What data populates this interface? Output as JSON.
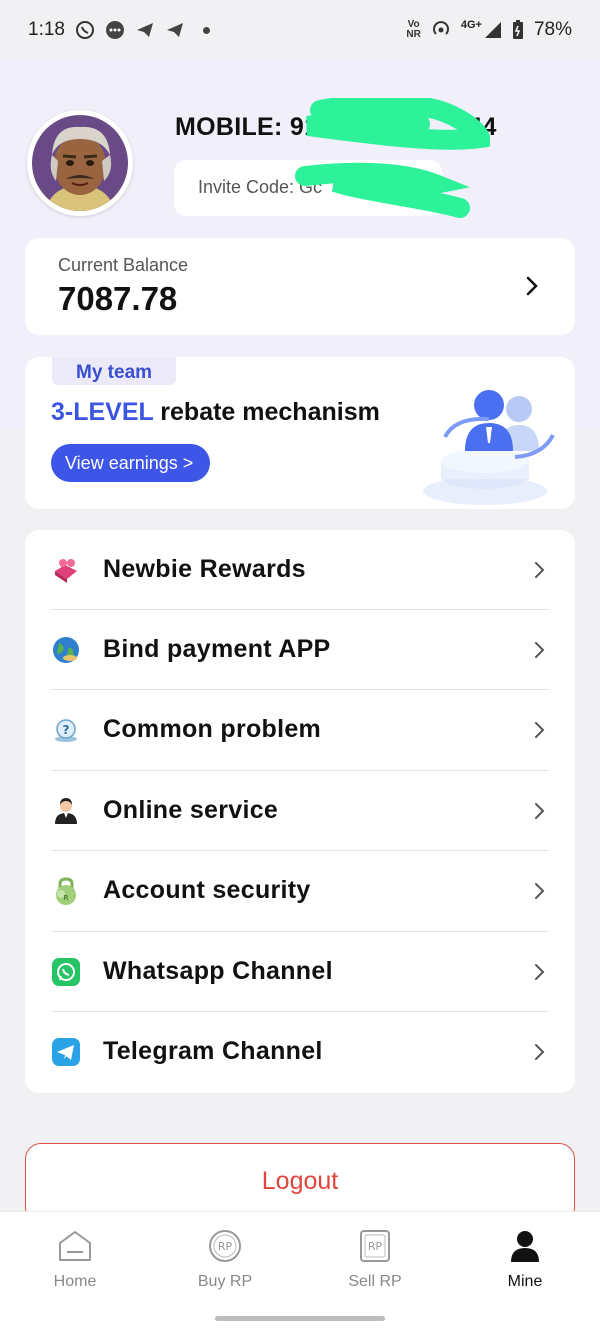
{
  "status_bar": {
    "time": "1:18",
    "volte_line1": "Vo",
    "volte_line2": "NR",
    "network": "4G+",
    "battery": "78%"
  },
  "profile": {
    "mobile": "MOBILE: 91",
    "mobile_tail": "44",
    "invite_code": "Invite Code: Gc"
  },
  "balance": {
    "label": "Current Balance",
    "amount": "7087.78"
  },
  "team": {
    "tag": "My team",
    "title_highlight": "3-LEVEL",
    "title_rest": " rebate mechanism",
    "button": "View earnings >"
  },
  "menu": {
    "items": [
      {
        "label": "Newbie Rewards",
        "icon": "gift-icon"
      },
      {
        "label": "Bind payment APP",
        "icon": "globe-icon"
      },
      {
        "label": "Common problem",
        "icon": "help-icon"
      },
      {
        "label": "Online service",
        "icon": "support-agent-icon"
      },
      {
        "label": "Account security",
        "icon": "lock-icon"
      },
      {
        "label": "Whatsapp Channel",
        "icon": "whatsapp-icon"
      },
      {
        "label": "Telegram Channel",
        "icon": "telegram-icon"
      }
    ]
  },
  "logout": "Logout",
  "nav": {
    "items": [
      {
        "label": "Home",
        "icon": "home-icon"
      },
      {
        "label": "Buy RP",
        "icon": "buy-rp-icon"
      },
      {
        "label": "Sell RP",
        "icon": "sell-rp-icon"
      },
      {
        "label": "Mine",
        "icon": "user-icon",
        "active": true
      }
    ]
  },
  "colors": {
    "accent": "#3e56e8",
    "logout": "#e0453c",
    "redaction": "#2ef29a"
  }
}
